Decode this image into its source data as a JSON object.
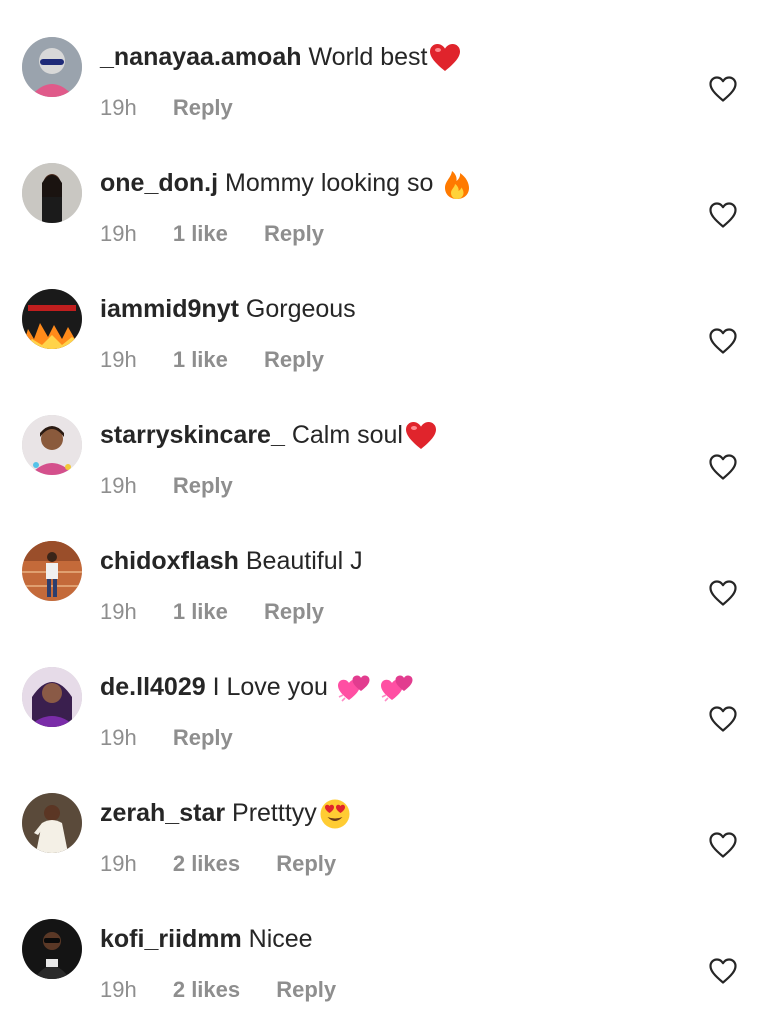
{
  "comments": [
    {
      "username": "_nanayaa.amoah",
      "text": "World best",
      "emoji": [
        "red-heart"
      ],
      "time": "19h",
      "likes": "",
      "reply": "Reply"
    },
    {
      "username": "one_don.j",
      "text": "Mommy looking so",
      "emoji": [
        "fire"
      ],
      "time": "19h",
      "likes": "1 like",
      "reply": "Reply"
    },
    {
      "username": "iammid9nyt",
      "text": "Gorgeous",
      "emoji": [],
      "time": "19h",
      "likes": "1 like",
      "reply": "Reply"
    },
    {
      "username": "starryskincare_",
      "text": "Calm soul",
      "emoji": [
        "red-heart"
      ],
      "time": "19h",
      "likes": "",
      "reply": "Reply"
    },
    {
      "username": "chidoxflash",
      "text": "Beautiful J",
      "emoji": [],
      "time": "19h",
      "likes": "1 like",
      "reply": "Reply"
    },
    {
      "username": "de.ll4029",
      "text": "I Love you",
      "emoji": [
        "two-hearts",
        "two-hearts"
      ],
      "time": "19h",
      "likes": "",
      "reply": "Reply"
    },
    {
      "username": "zerah_star",
      "text": "Pretttyy",
      "emoji": [
        "heart-eyes"
      ],
      "time": "19h",
      "likes": "2 likes",
      "reply": "Reply"
    },
    {
      "username": "kofi_riidmm",
      "text": "Nicee",
      "emoji": [],
      "time": "19h",
      "likes": "2 likes",
      "reply": "Reply"
    }
  ],
  "colors": {
    "text": "#262626",
    "meta": "#8e8e8e",
    "heart_icon": "#262626",
    "emoji_red": "#e0242c",
    "emoji_pink": "#ff4fa3",
    "emoji_fire": "#ff7a00"
  }
}
